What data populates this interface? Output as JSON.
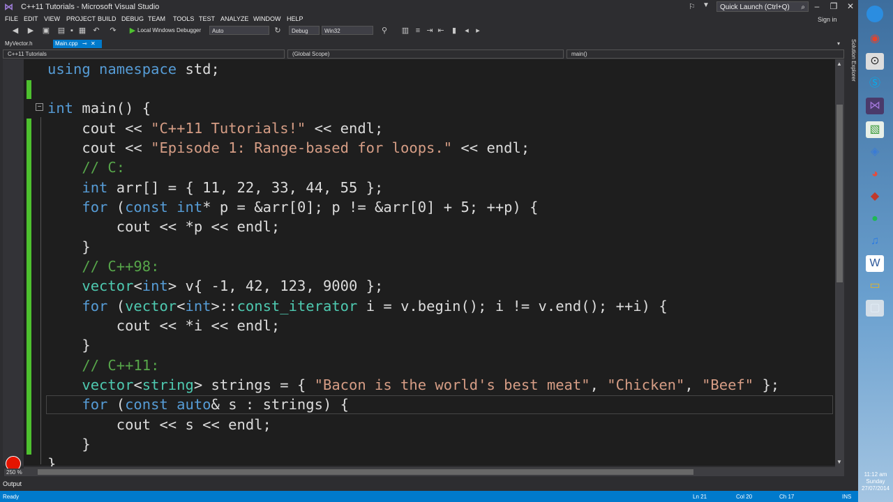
{
  "window": {
    "title": "C++11 Tutorials - Microsoft Visual Studio",
    "quick_launch_placeholder": "Quick Launch (Ctrl+Q)",
    "sign_in": "Sign in"
  },
  "menu": [
    "FILE",
    "EDIT",
    "VIEW",
    "PROJECT",
    "BUILD",
    "DEBUG",
    "TEAM",
    "TOOLS",
    "TEST",
    "ANALYZE",
    "WINDOW",
    "HELP"
  ],
  "toolbar": {
    "run_label": "Local Windows Debugger",
    "auto_value": "Auto",
    "config_value": "Debug",
    "platform_value": "Win32"
  },
  "tabs": {
    "myvector": "MyVector.h",
    "main": "Main.cpp"
  },
  "navbar": {
    "project": "C++11 Tutorials",
    "scope": "(Global Scope)",
    "function": "main()"
  },
  "code": {
    "l1_a": "using namespace",
    "l1_b": " std;",
    "l3_a": "int",
    "l3_b": " main() {",
    "l4_a": "    cout << ",
    "l4_b": "\"C++11 Tutorials!\"",
    "l4_c": " << endl;",
    "l5_a": "    cout << ",
    "l5_b": "\"Episode 1: Range-based for loops.\"",
    "l5_c": " << endl;",
    "l6": "    // C:",
    "l7_a": "int",
    "l7_b": " arr[] = { 11, 22, 33, 44, 55 };",
    "l8_a": "for",
    "l8_b": " (",
    "l8_c": "const int",
    "l8_d": "* p = &arr[0]; p != &arr[0] + 5; ++p) {",
    "l9": "        cout << *p << endl;",
    "l10": "    }",
    "l11": "    // C++98:",
    "l12_a": "vector",
    "l12_b": "<",
    "l12_c": "int",
    "l12_d": "> v{ -1, 42, 123, 9000 };",
    "l13_a": "for",
    "l13_b": " (",
    "l13_c": "vector",
    "l13_d": "<",
    "l13_e": "int",
    "l13_f": ">::",
    "l13_g": "const_iterator",
    "l13_h": " i = v.begin(); i != v.end(); ++i) {",
    "l14": "        cout << *i << endl;",
    "l15": "    }",
    "l16": "    // C++11:",
    "l17_a": "vector",
    "l17_b": "<",
    "l17_c": "string",
    "l17_d": "> strings = { ",
    "l17_e": "\"Bacon is the world's best meat\"",
    "l17_f": ", ",
    "l17_g": "\"Chicken\"",
    "l17_h": ", ",
    "l17_i": "\"Beef\"",
    "l17_j": " };",
    "l18_a": "for",
    "l18_b": " (",
    "l18_c": "const auto",
    "l18_d": "& s : strings) {",
    "l19": "        cout << s << endl;",
    "l20": "    }",
    "l21": "}"
  },
  "zoom": "250 %",
  "side_panel": "Solution Explorer",
  "output_label": "Output",
  "status": {
    "ready": "Ready",
    "ln": "Ln 21",
    "col": "Col 20",
    "ch": "Ch 17",
    "mode": "INS"
  },
  "clock": {
    "time": "11:12 am",
    "day": "Sunday",
    "date": "27/07/2014"
  },
  "colors": {
    "accent": "#007acc",
    "keyword": "#569cd6",
    "string": "#d69d85",
    "comment": "#57a64a",
    "type": "#4ec9b0",
    "change_bar": "#4ec12f"
  }
}
